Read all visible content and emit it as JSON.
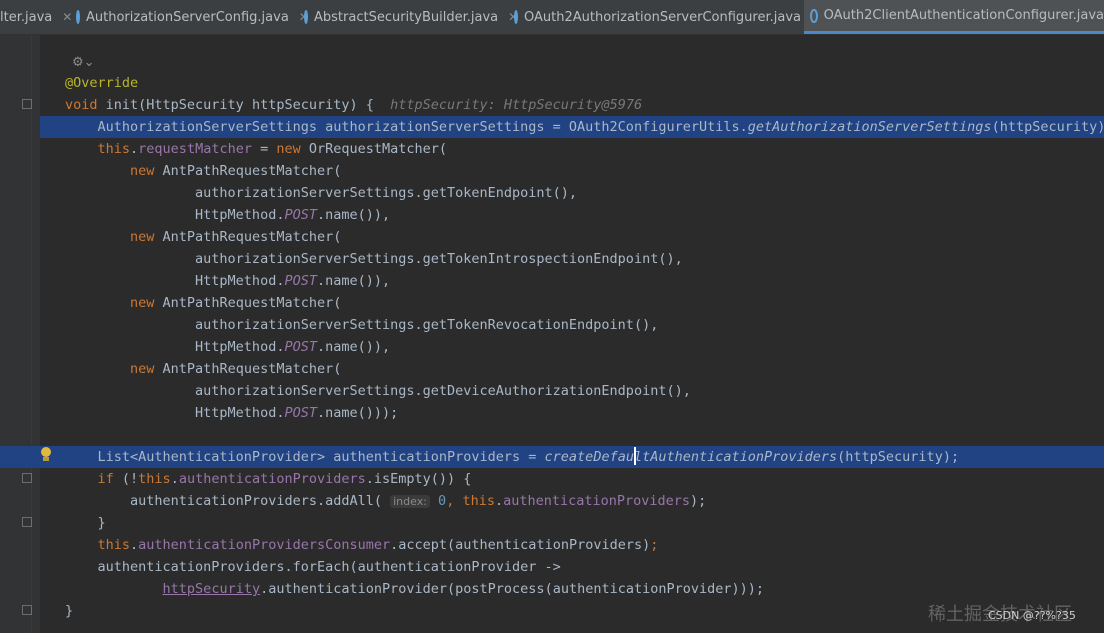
{
  "tabs": [
    {
      "label": "lter.java",
      "active": false
    },
    {
      "label": "AuthorizationServerConfig.java",
      "active": false
    },
    {
      "label": "AbstractSecurityBuilder.java",
      "active": false
    },
    {
      "label": "OAuth2AuthorizationServerConfigurer.java",
      "active": false
    },
    {
      "label": "OAuth2ClientAuthenticationConfigurer.java",
      "active": true
    }
  ],
  "close_glyph": "✕",
  "gear_glyph": "⚙⌄",
  "code": {
    "annotation": "@Override",
    "l_void": "void ",
    "l_init": "init(HttpSecurity httpSecurity) {  ",
    "l_hint": "httpSecurity: HttpSecurity@5976",
    "l3_a": "    AuthorizationServerSettings authorizationServerSettings = OAuth2ConfigurerUtils.",
    "l3_b": "getAuthorizationServerSettings",
    "l3_c": "(httpSecurity);",
    "l4_this": "    this",
    "l4_dot": ".",
    "l4_field": "requestMatcher",
    "l4_eq": " = ",
    "l4_new": "new ",
    "l4_rest": "OrRequestMatcher(",
    "new_kw": "        new ",
    "apm": "AntPathRequestMatcher(",
    "tok": "                authorizationServerSettings.getTokenEndpoint(),",
    "hm_a": "                HttpMethod.",
    "post": "POST",
    "hm_b": ".name()),",
    "hm_last": ".name()));",
    "intro": "                authorizationServerSettings.getTokenIntrospectionEndpoint(),",
    "revoc": "                authorizationServerSettings.getTokenRevocationEndpoint(),",
    "device": "                authorizationServerSettings.getDeviceAuthorizationEndpoint(),",
    "l16_a": "    List<AuthenticationProvider> authenticationProviders = ",
    "l16_b": "createDefaultAuthenticationProviders",
    "l16_c": "(httpSecurity);",
    "l17_if": "    if ",
    "l17_p": "(!",
    "l17_this": "this",
    "l17_dot": ".",
    "l17_field": "authenticationProviders",
    "l17_rest": ".isEmpty()) {",
    "l18_a": "        authenticationProviders.addAll( ",
    "l18_inlay": "index:",
    "l18_num": " 0",
    "l18_comma": ", ",
    "l18_this": "this",
    "l18_dot": ".",
    "l18_field": "authenticationProviders",
    "l18_end": ");",
    "l19": "    }",
    "l20_this": "    this",
    "l20_dot": ".",
    "l20_field": "authenticationProvidersConsumer",
    "l20_rest": ".accept(authenticationProviders)",
    "l20_semi": ";",
    "l21": "    authenticationProviders.forEach(authenticationProvider ->",
    "l22_ind": "            ",
    "l22_u": "httpSecurity",
    "l22_rest": ".authenticationProvider(postProcess(authenticationProvider)));",
    "l23": "}"
  },
  "watermark": "CSDN @??%?35",
  "watermark_bg": "稀土掘金技术社区",
  "colors": {
    "highlight": "#214283",
    "keyword": "#cc7832",
    "annotation": "#bbb529",
    "field": "#9876aa",
    "text": "#a9b7c6"
  }
}
